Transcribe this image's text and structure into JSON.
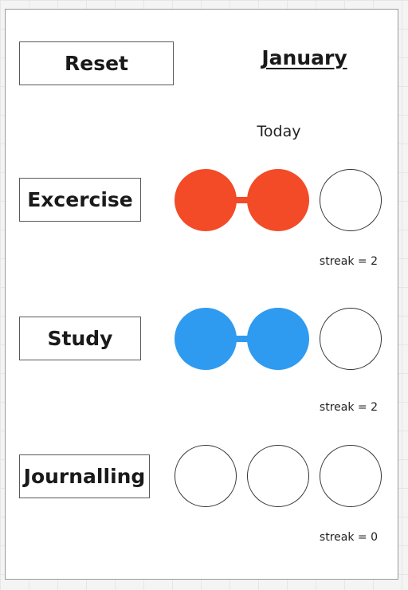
{
  "reset_label": "Reset",
  "month": "January",
  "today_label": "Today",
  "habits": [
    {
      "name": "Excercise",
      "color": "#f34a27",
      "days": [
        true,
        true,
        false
      ],
      "streak_text": "streak = 2"
    },
    {
      "name": "Study",
      "color": "#2e9bf0",
      "days": [
        true,
        true,
        false
      ],
      "streak_text": "streak = 2"
    },
    {
      "name": "Journalling",
      "color": "#2e9bf0",
      "days": [
        false,
        false,
        false
      ],
      "streak_text": "streak = 0"
    }
  ]
}
